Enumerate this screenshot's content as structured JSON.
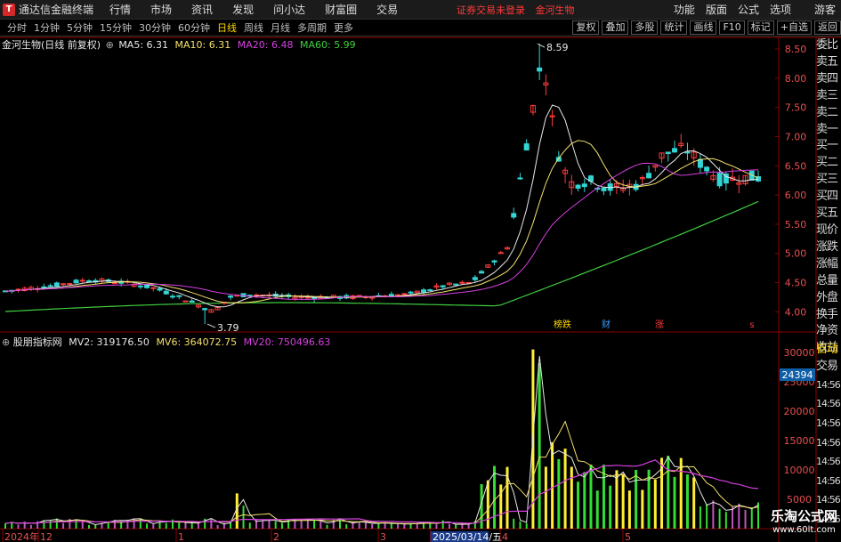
{
  "app": {
    "title": "通达信金融终端"
  },
  "top_menu": [
    "行情",
    "市场",
    "资讯",
    "发现",
    "问小达",
    "财富圈",
    "交易"
  ],
  "notice": {
    "text": "证券交易未登录",
    "stock": "金河生物"
  },
  "right_menu": [
    "功能",
    "版面",
    "公式",
    "选项"
  ],
  "guest": "游客",
  "periods": [
    "分时",
    "1分钟",
    "5分钟",
    "15分钟",
    "30分钟",
    "60分钟",
    "日线",
    "周线",
    "月线",
    "多周期",
    "更多"
  ],
  "active_period": "日线",
  "tools": [
    "复权",
    "叠加",
    "多股",
    "统计",
    "画线",
    "F10",
    "标记",
    "+自选",
    "返回"
  ],
  "main": {
    "label": "金河生物(日线 前复权)",
    "ma": [
      {
        "name": "MA5",
        "value": "6.31",
        "color": "#e8e8e8"
      },
      {
        "name": "MA10",
        "value": "6.31",
        "color": "#f5e06a"
      },
      {
        "name": "MA20",
        "value": "6.48",
        "color": "#d63fe0"
      },
      {
        "name": "MA60",
        "value": "5.99",
        "color": "#3fcf3f"
      }
    ],
    "high_label": "8.59",
    "low_label": "3.79",
    "events": [
      {
        "text": "榜跌",
        "color": "#ffd700"
      },
      {
        "text": "财",
        "color": "#3b9cff"
      },
      {
        "text": "涨",
        "color": "#ff3a3a"
      },
      {
        "text": "s",
        "color": "#ff3a3a"
      }
    ],
    "y_ticks": [
      "8.50",
      "8.00",
      "7.50",
      "7.00",
      "6.50",
      "6.00",
      "5.50",
      "5.00",
      "4.50",
      "4.00"
    ]
  },
  "indicator": {
    "label": "股朋指标网",
    "mv": [
      {
        "name": "MV2",
        "value": "319176.50",
        "color": "#e8e8e8"
      },
      {
        "name": "MV6",
        "value": "364072.75",
        "color": "#f5e06a"
      },
      {
        "name": "MV20",
        "value": "750496.63",
        "color": "#d63fe0"
      }
    ],
    "y_ticks": [
      "30000",
      "25000",
      "20000",
      "15000",
      "10000",
      "5000"
    ],
    "marker_value": "24394"
  },
  "side_panel": [
    "委比",
    "卖五",
    "卖四",
    "卖三",
    "卖二",
    "卖一",
    "买一",
    "买二",
    "买三",
    "买四",
    "买五",
    "现价",
    "涨跌",
    "涨幅",
    "总量",
    "外盘",
    "换手",
    "净资",
    "收益"
  ],
  "side_lower": [
    "自动",
    "交易"
  ],
  "side_times": [
    "14:56",
    "14:56",
    "14:56",
    "14:56",
    "14:56",
    "14:56",
    "14:56",
    "14:56"
  ],
  "x_axis": [
    "2024年",
    "12",
    "1",
    "2",
    "3",
    "2025/03/14/五",
    "4",
    "5"
  ],
  "watermark": {
    "line1": "乐淘公式网",
    "line2": "www.60lt.com"
  },
  "colors": {
    "up": "#ff3c3c",
    "down": "#32d4d4",
    "ma5": "#e8e8e8",
    "ma10": "#f5e06a",
    "ma20": "#d63fe0",
    "ma60": "#3fcf3f",
    "grid": "#8b0000"
  },
  "chart_data": {
    "type": "candlestick",
    "y_range": [
      3.7,
      8.7
    ],
    "high": 8.59,
    "low": 3.79,
    "ma5_last": 6.31,
    "ma10_last": 6.31,
    "ma20_last": 6.48,
    "ma60_last": 5.99
  }
}
